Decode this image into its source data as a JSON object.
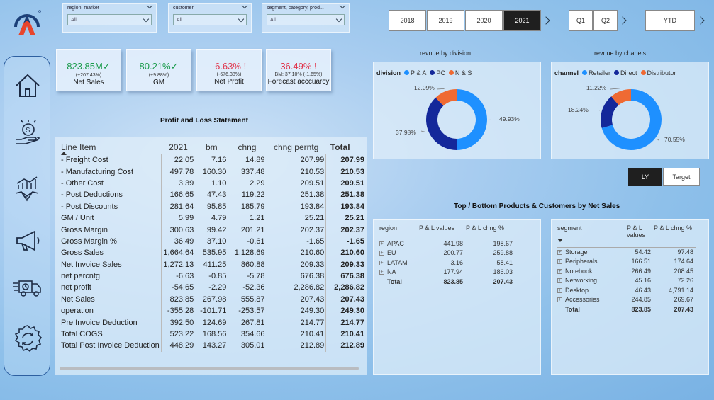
{
  "filters": [
    {
      "label": "region, market",
      "value": "All"
    },
    {
      "label": "customer",
      "value": "All"
    },
    {
      "label": "segment, category, prod...",
      "value": "All"
    }
  ],
  "years": [
    "2018",
    "2019",
    "2020",
    "2021"
  ],
  "selected_year": "2021",
  "quarters": [
    "Q1",
    "Q2"
  ],
  "ytd": "YTD",
  "kpis": [
    {
      "value": "823.85M",
      "sub": "(+207.43%)",
      "name": "Net Sales",
      "mark": "✓"
    },
    {
      "value": "80.21%",
      "sub": "(+9.88%)",
      "name": "GM",
      "mark": "✓"
    },
    {
      "value": "-6.63%",
      "sub": "(-676.38%)",
      "name": "Net Profit",
      "mark": "!"
    },
    {
      "value": "36.49%",
      "sub": "BM: 37.10% (-1.65%)",
      "name": "Forecast acccuarcy",
      "mark": "!"
    }
  ],
  "nav": [
    "home-icon",
    "money-hand-icon",
    "handshake-chart-icon",
    "megaphone-icon",
    "delivery-truck-icon",
    "settings-icon"
  ],
  "pl": {
    "title": "Profit and Loss Statement",
    "headers": [
      "Line Item",
      "2021",
      "bm",
      "chng",
      "chng perntg",
      "Total"
    ],
    "rows": [
      [
        "- Freight Cost",
        "22.05",
        "7.16",
        "14.89",
        "207.99",
        "207.99"
      ],
      [
        "- Manufacturing Cost",
        "497.78",
        "160.30",
        "337.48",
        "210.53",
        "210.53"
      ],
      [
        "- Other Cost",
        "3.39",
        "1.10",
        "2.29",
        "209.51",
        "209.51"
      ],
      [
        "- Post Deductions",
        "166.65",
        "47.43",
        "119.22",
        "251.38",
        "251.38"
      ],
      [
        "- Post Discounts",
        "281.64",
        "95.85",
        "185.79",
        "193.84",
        "193.84"
      ],
      [
        "GM / Unit",
        "5.99",
        "4.79",
        "1.21",
        "25.21",
        "25.21"
      ],
      [
        "Gross Margin",
        "300.63",
        "99.42",
        "201.21",
        "202.37",
        "202.37"
      ],
      [
        "Gross Margin %",
        "36.49",
        "37.10",
        "-0.61",
        "-1.65",
        "-1.65"
      ],
      [
        "Gross Sales",
        "1,664.64",
        "535.95",
        "1,128.69",
        "210.60",
        "210.60"
      ],
      [
        "Net Invoice Sales",
        "1,272.13",
        "411.25",
        "860.88",
        "209.33",
        "209.33"
      ],
      [
        "net percntg",
        "-6.63",
        "-0.85",
        "-5.78",
        "676.38",
        "676.38"
      ],
      [
        "net profit",
        "-54.65",
        "-2.29",
        "-52.36",
        "2,286.82",
        "2,286.82"
      ],
      [
        "Net Sales",
        "823.85",
        "267.98",
        "555.87",
        "207.43",
        "207.43"
      ],
      [
        "operation",
        "-355.28",
        "-101.71",
        "-253.57",
        "249.30",
        "249.30"
      ],
      [
        "Pre Invoice Deduction",
        "392.50",
        "124.69",
        "267.81",
        "214.77",
        "214.77"
      ],
      [
        "Total COGS",
        "523.22",
        "168.56",
        "354.66",
        "210.41",
        "210.41"
      ],
      [
        "Total Post Invoice Deduction",
        "448.29",
        "143.27",
        "305.01",
        "212.89",
        "212.89"
      ]
    ]
  },
  "division_chart": {
    "title": "revnue by division",
    "legend_title": "division",
    "colors": {
      "P & A": "#1e90ff",
      "PC": "#14289a",
      "N & S": "#ef6a33"
    }
  },
  "channel_chart": {
    "title": "revnue by chanels",
    "legend_title": "channel",
    "colors": {
      "Retailer": "#1e90ff",
      "Direct": "#14289a",
      "Distributor": "#ef6a33"
    }
  },
  "chart_data": [
    {
      "type": "pie",
      "title": "revnue by division",
      "categories": [
        "P & A",
        "PC",
        "N & S"
      ],
      "values": [
        49.93,
        37.98,
        12.09
      ],
      "labels": [
        "49.93%",
        "37.98%",
        "12.09%"
      ]
    },
    {
      "type": "pie",
      "title": "revnue by chanels",
      "categories": [
        "Retailer",
        "Direct",
        "Distributor"
      ],
      "values": [
        70.55,
        18.24,
        11.22
      ],
      "labels": [
        "70.55%",
        "18.24%",
        "11.22%"
      ]
    }
  ],
  "toggle": {
    "ly": "LY",
    "target": "Target"
  },
  "topbottom_title": "Top / Bottom Products & Customers by Net Sales",
  "region_table": {
    "headers": [
      "region",
      "P & L values",
      "P & L chng %"
    ],
    "rows": [
      [
        "APAC",
        "441.98",
        "198.67"
      ],
      [
        "EU",
        "200.77",
        "259.88"
      ],
      [
        "LATAM",
        "3.16",
        "58.41"
      ],
      [
        "NA",
        "177.94",
        "186.03"
      ]
    ],
    "total": [
      "Total",
      "823.85",
      "207.43"
    ]
  },
  "segment_table": {
    "headers": [
      "segment",
      "P & L values",
      "P & L chng %"
    ],
    "rows": [
      [
        "Storage",
        "54.42",
        "97.48"
      ],
      [
        "Peripherals",
        "166.51",
        "174.64"
      ],
      [
        "Notebook",
        "266.49",
        "208.45"
      ],
      [
        "Networking",
        "45.16",
        "72.26"
      ],
      [
        "Desktop",
        "46.43",
        "4,791.14"
      ],
      [
        "Accessories",
        "244.85",
        "269.67"
      ]
    ],
    "total": [
      "Total",
      "823.85",
      "207.43"
    ]
  }
}
